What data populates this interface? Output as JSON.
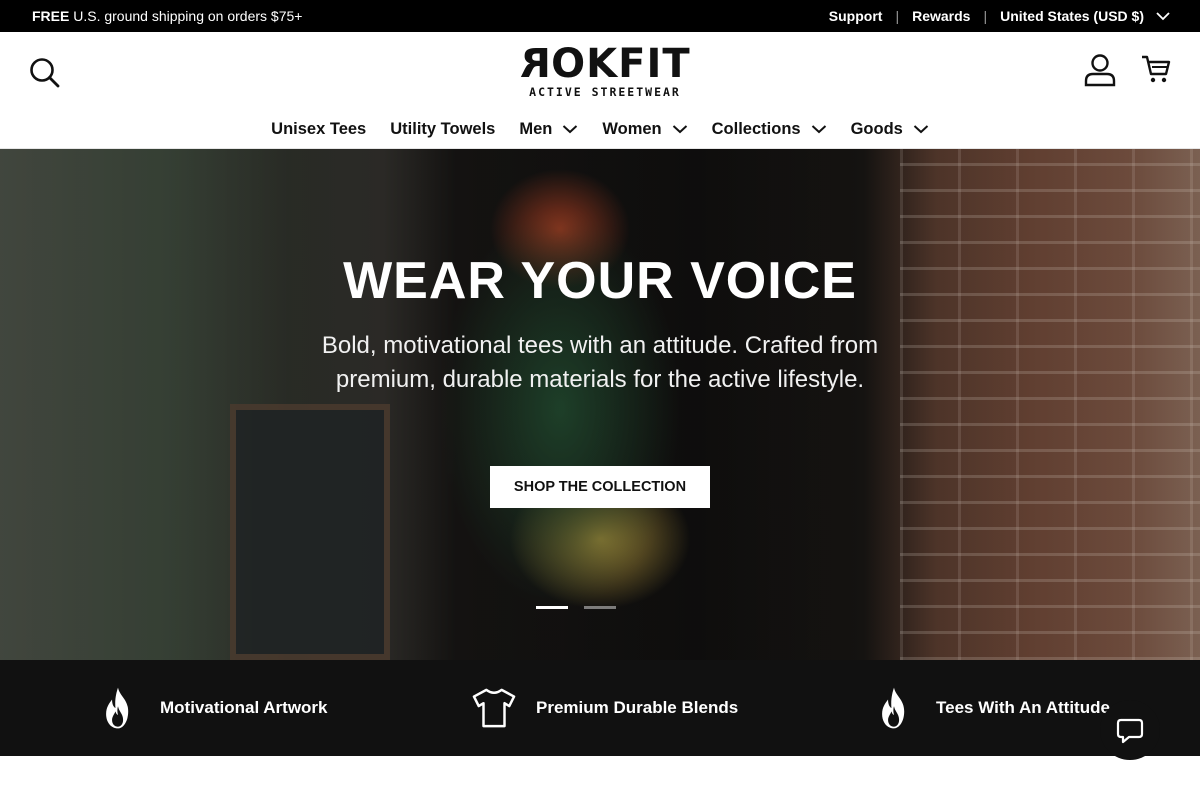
{
  "announcement": {
    "free_label": "FREE",
    "shipping_text": "U.S. ground shipping on orders $75+",
    "support_label": "Support",
    "rewards_label": "Rewards",
    "separator": "|",
    "region_label": "United States (USD $)"
  },
  "header": {
    "logo_text_main": "OKFIT",
    "logo_text_first": "R",
    "logo_tagline": "ACTIVE STREETWEAR",
    "icons": [
      "search-icon",
      "account-icon",
      "cart-icon"
    ]
  },
  "nav": {
    "items": [
      {
        "label": "Unisex Tees",
        "dropdown": false
      },
      {
        "label": "Utility Towels",
        "dropdown": false
      },
      {
        "label": "Men",
        "dropdown": true
      },
      {
        "label": "Women",
        "dropdown": true
      },
      {
        "label": "Collections",
        "dropdown": true
      },
      {
        "label": "Goods",
        "dropdown": true
      }
    ]
  },
  "hero": {
    "title": "WEAR YOUR VOICE",
    "subtitle": "Bold, motivational tees with an attitude. Crafted from premium, durable materials for the active lifestyle.",
    "cta_label": "SHOP THE COLLECTION",
    "slides_total": 2,
    "active_slide": 1
  },
  "features": {
    "items": [
      {
        "label": "Motivational Artwork",
        "icon": "flame-icon"
      },
      {
        "label": "Premium Durable Blends",
        "icon": "tshirt-icon"
      },
      {
        "label": "Tees With An Attitude",
        "icon": "flame-icon"
      }
    ]
  },
  "chat": {
    "icon": "chat-bubble-icon"
  },
  "colors": {
    "announcement_bg": "#000000",
    "features_bg": "#111111",
    "cta_bg": "#ffffff"
  }
}
